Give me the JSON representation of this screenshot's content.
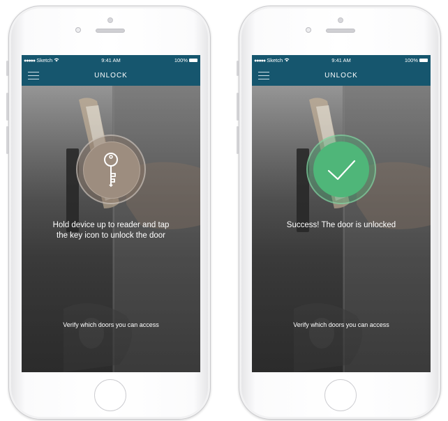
{
  "screens": [
    {
      "status": {
        "carrier": "Sketch",
        "time": "9:41 AM",
        "battery": "100%"
      },
      "nav": {
        "title": "UNLOCK"
      },
      "action_icon": "key-icon",
      "message_line1": "Hold device up to reader and tap",
      "message_line2": "the key icon to unlock the door",
      "link": "Verify which doors you can access"
    },
    {
      "status": {
        "carrier": "Sketch",
        "time": "9:41 AM",
        "battery": "100%"
      },
      "nav": {
        "title": "UNLOCK"
      },
      "action_icon": "checkmark-icon",
      "message_line1": "Success! The door is unlocked",
      "link": "Verify which doors you can access"
    }
  ],
  "colors": {
    "nav_bar": "#16566e",
    "success_green": "#4fb679",
    "key_circle": "#9d8d7f"
  }
}
